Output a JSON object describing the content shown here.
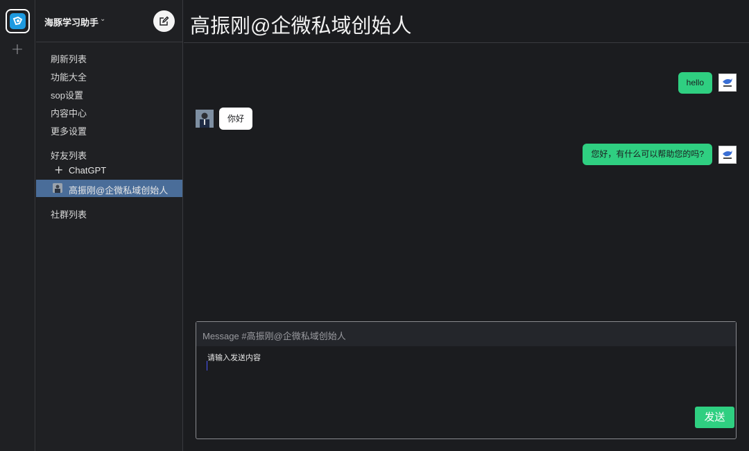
{
  "rail": {
    "logo_icon": "app-logo-icon",
    "add_icon": "plus-icon",
    "add_symbol": "+"
  },
  "sidebar": {
    "app_name": "海豚学习助手",
    "chevron": "⌄",
    "menu_items": [
      {
        "label": "刷新列表"
      },
      {
        "label": "功能大全"
      },
      {
        "label": "sop设置"
      },
      {
        "label": "内容中心"
      },
      {
        "label": "更多设置"
      }
    ],
    "friends_section": "好友列表",
    "friends": [
      {
        "label": "ChatGPT",
        "selected": false
      },
      {
        "label": "高振刚@企微私域创始人",
        "selected": true
      }
    ],
    "groups_section": "社群列表"
  },
  "chat": {
    "title": "高振刚@企微私域创始人",
    "messages": [
      {
        "direction": "out",
        "text": "hello"
      },
      {
        "direction": "in",
        "text": "你好"
      },
      {
        "direction": "out",
        "text": "您好，有什么可以帮助您的吗?"
      }
    ]
  },
  "composer": {
    "placeholder": "Message #高振刚@企微私域创始人",
    "hint": "请输入发送内容",
    "send_label": "发送"
  },
  "colors": {
    "accent_green": "#2fcf81",
    "selected_row": "#4a6d99",
    "background": "#1b1c1f"
  }
}
